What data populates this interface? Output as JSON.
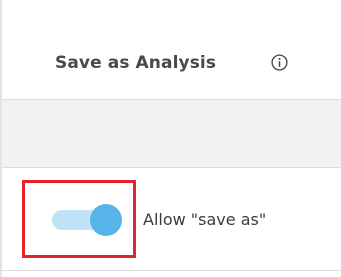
{
  "header": {
    "title": "Save as Analysis",
    "info_icon": "info-circle-icon"
  },
  "setting": {
    "label": "Allow \"save as\"",
    "enabled": true
  },
  "colors": {
    "toggle_track": "#bfe3f6",
    "toggle_knob": "#56b4e9",
    "highlight_border": "#e3242b",
    "band_background": "#f2f2f2"
  }
}
